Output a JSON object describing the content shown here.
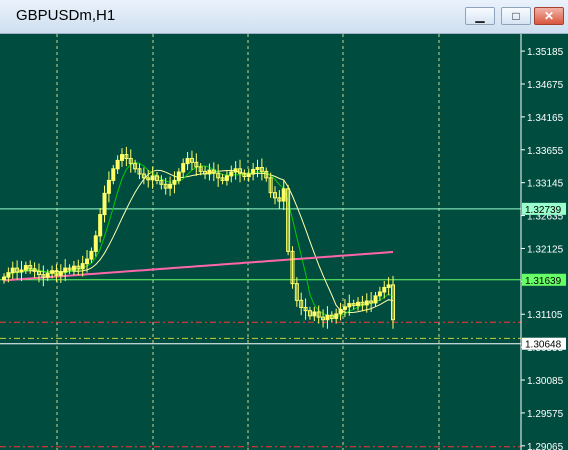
{
  "window": {
    "title": "GBPUSDm,H1",
    "controls": {
      "minimize": "▁",
      "maximize": "□",
      "close": "✕"
    }
  },
  "colors": {
    "background": "#004d40",
    "grid": "#d4d48a",
    "candle": "#ffff66",
    "ma_fast": "#00cc00",
    "ma_slow": "#ffffaa",
    "ma_long": "#ff66aa",
    "hline_upper": "#99ffcc",
    "hline_price": "#66ff66",
    "hline_lower": "#ffffff",
    "red_dash": "#ff3333",
    "yellow_dash": "#cccc33"
  },
  "chart_data": {
    "type": "candlestick",
    "symbol": "GBPUSDm",
    "timeframe": "H1",
    "ylim": [
      1.29,
      1.3545
    ],
    "y_ticks": [
      "1.35185",
      "1.34675",
      "1.34165",
      "1.33655",
      "1.33145",
      "1.32635",
      "1.32125",
      "1.31615",
      "1.31105",
      "1.30595",
      "1.30085",
      "1.29575",
      "1.29065"
    ],
    "price_boxes": [
      {
        "label": "1.32739",
        "value": 1.32739,
        "color": "#99ffcc"
      },
      {
        "label": "1.31639",
        "value": 1.31639,
        "color": "#66ff66"
      },
      {
        "label": "1.30648",
        "value": 1.30648,
        "color": "#ffffff"
      }
    ],
    "dashed_levels": [
      {
        "value": 1.3098,
        "color": "#ff3333"
      },
      {
        "value": 1.3073,
        "color": "#cccc33"
      },
      {
        "value": 1.2905,
        "color": "#ff3333"
      }
    ],
    "closes": [
      1.3168,
      1.3175,
      1.3182,
      1.3176,
      1.3179,
      1.3186,
      1.3181,
      1.3177,
      1.3172,
      1.3168,
      1.3174,
      1.3178,
      1.3171,
      1.3176,
      1.3182,
      1.3179,
      1.3185,
      1.3181,
      1.3189,
      1.3196,
      1.3208,
      1.3232,
      1.3265,
      1.3298,
      1.3318,
      1.3336,
      1.3349,
      1.3358,
      1.3352,
      1.3344,
      1.3336,
      1.3328,
      1.3322,
      1.3319,
      1.3325,
      1.3318,
      1.3312,
      1.3306,
      1.3312,
      1.3318,
      1.3331,
      1.3344,
      1.3352,
      1.3346,
      1.3339,
      1.3332,
      1.3328,
      1.3334,
      1.3329,
      1.3322,
      1.3318,
      1.3325,
      1.3331,
      1.3336,
      1.3329,
      1.3324,
      1.3328,
      1.3335,
      1.3338,
      1.3332,
      1.3322,
      1.3299,
      1.3291,
      1.3286,
      1.3305,
      1.3208,
      1.3158,
      1.3132,
      1.3121,
      1.3116,
      1.3108,
      1.3114,
      1.3106,
      1.3102,
      1.3109,
      1.3104,
      1.3111,
      1.3118,
      1.3122,
      1.3127,
      1.3124,
      1.3129,
      1.3125,
      1.3131,
      1.3128,
      1.3139,
      1.3145,
      1.3152,
      1.3156,
      1.3102
    ]
  }
}
